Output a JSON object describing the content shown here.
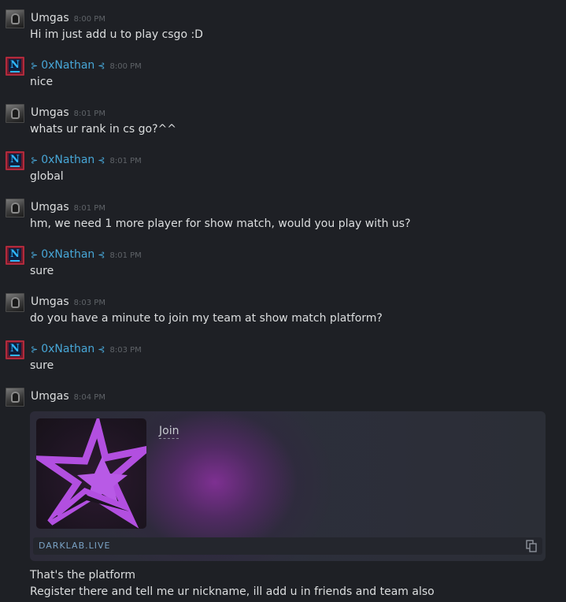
{
  "messages": [
    {
      "author": "Umgas",
      "time": "8:00 PM",
      "text": "Hi im just add u to play csgo :D"
    },
    {
      "author": "0xNathan",
      "time": "8:00 PM",
      "text": "nice"
    },
    {
      "author": "Umgas",
      "time": "8:01 PM",
      "text": "whats ur rank in cs go?^^"
    },
    {
      "author": "0xNathan",
      "time": "8:01 PM",
      "text": "global"
    },
    {
      "author": "Umgas",
      "time": "8:01 PM",
      "text": "hm, we need 1 more player for show match, would you play with us?"
    },
    {
      "author": "0xNathan",
      "time": "8:01 PM",
      "text": "sure"
    },
    {
      "author": "Umgas",
      "time": "8:03 PM",
      "text": "do you have a minute to join my team at show match platform?"
    },
    {
      "author": "0xNathan",
      "time": "8:03 PM",
      "text": "sure"
    },
    {
      "author": "Umgas",
      "time": "8:04 PM",
      "text": ""
    }
  ],
  "embed": {
    "link_text": "Join",
    "domain": "DARKLAB.LIVE",
    "image_icon": "purple-star-logo",
    "copy_icon": "copy-icon"
  },
  "followup": {
    "line1": "That's the platform",
    "line2": "Register there and tell me ur nickname, ill add u in friends and team also"
  },
  "colors": {
    "background": "#1e2025",
    "friend_name": "#47a6d6",
    "text": "#dcdedf",
    "timestamp": "#5f6368",
    "embed_accent": "#a24fd0"
  }
}
